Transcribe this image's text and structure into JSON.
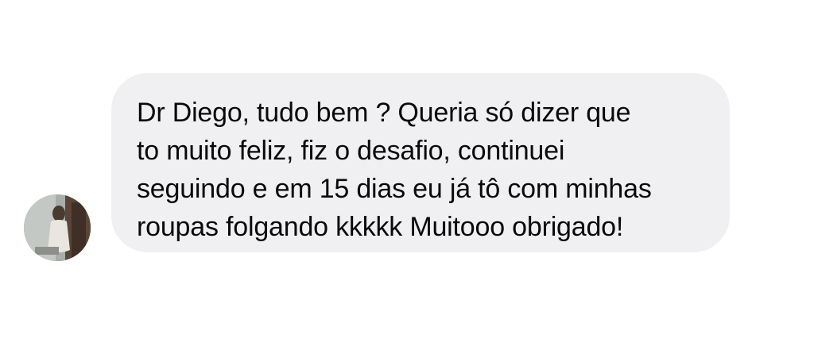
{
  "conversation": {
    "message": {
      "lines": [
        "Dr Diego, tudo bem ? Queria só dizer que",
        "to muito feliz, fiz o desafio, continuei",
        "seguindo e em 15 dias eu já tô com minhas",
        "roupas folgando kkkkk Muitooo obrigado!"
      ]
    }
  },
  "colors": {
    "bubble_background": "#f0f0f3",
    "text": "#0a0a0a",
    "page_background": "#ffffff"
  }
}
